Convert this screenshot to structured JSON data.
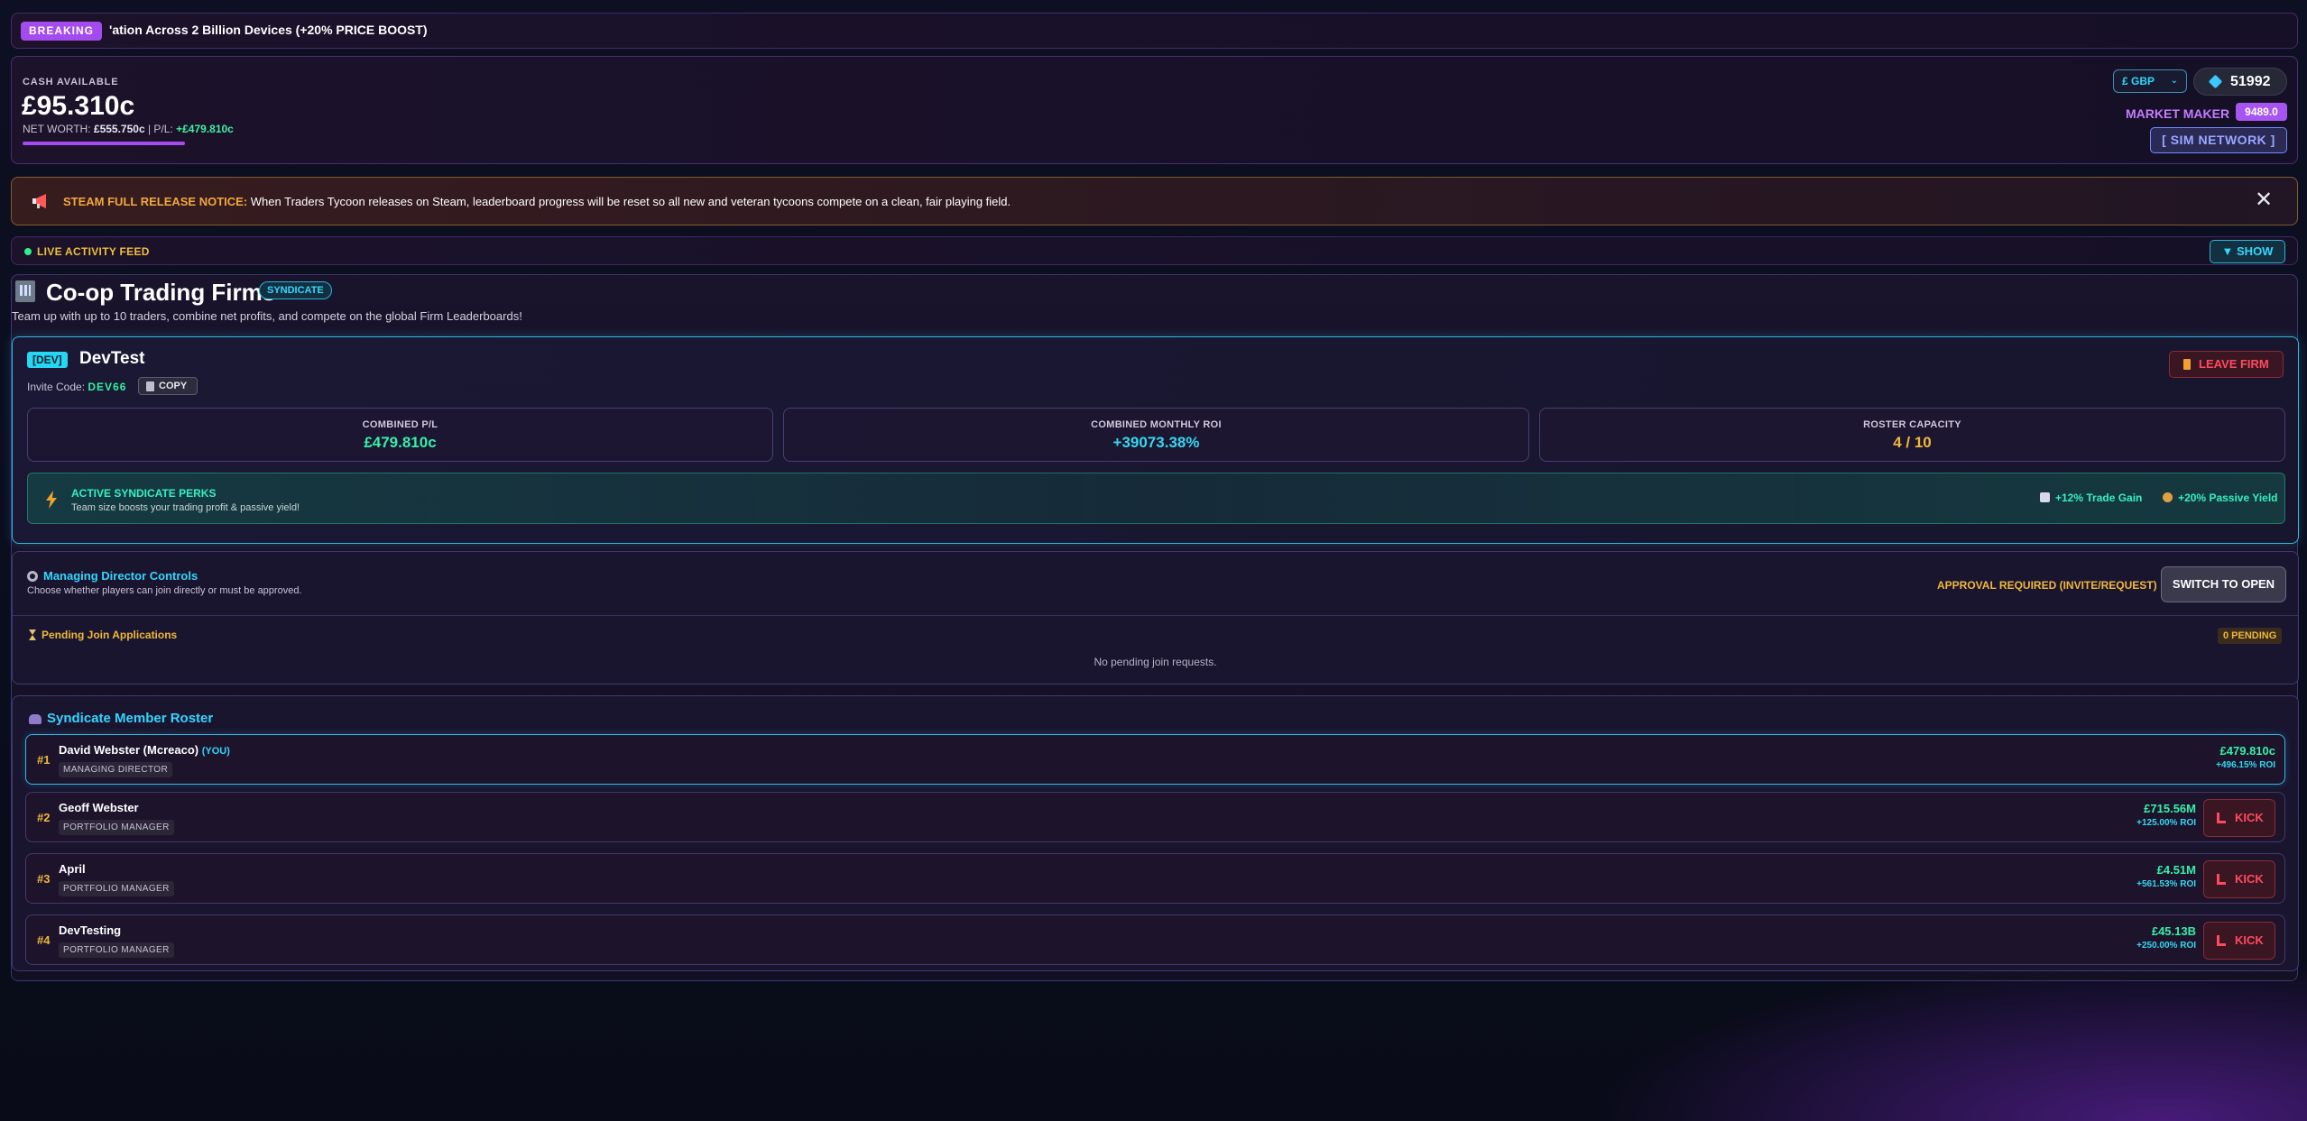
{
  "ticker": {
    "badge": "BREAKING",
    "text": "'ation Across 2 Billion Devices (+20% PRICE BOOST)"
  },
  "header": {
    "cash_label": "CASH AVAILABLE",
    "cash": "£95.310c",
    "networth_label": "NET WORTH:",
    "networth_value": "£555.750c",
    "pl_label": "| P/L:",
    "pl_value": "+£479.810c",
    "currency": "£ GBP",
    "gems": "51992",
    "rank_label": "MARKET MAKER",
    "rank_value": "9489.0",
    "sim_button": "[ SIM NETWORK ]"
  },
  "notice": {
    "title": "STEAM FULL RELEASE NOTICE:",
    "text": "When Traders Tycoon releases on Steam, leaderboard progress will be reset so all new and veteran tycoons compete on a clean, fair playing field."
  },
  "feed": {
    "label": "LIVE ACTIVITY FEED",
    "toggle": "▼ SHOW"
  },
  "page": {
    "title": "Co-op Trading Firms",
    "badge": "SYNDICATE",
    "subtitle": "Team up with up to 10 traders, combine net profits, and compete on the global Firm Leaderboards!"
  },
  "firm": {
    "tag": "[DEV]",
    "name": "DevTest",
    "invite_label": "Invite Code:",
    "invite_code": "DEV66",
    "copy": "COPY",
    "leave": "LEAVE FIRM",
    "stats": [
      {
        "label": "COMBINED P/L",
        "value": "£479.810c",
        "color": "#35f0a8"
      },
      {
        "label": "COMBINED MONTHLY ROI",
        "value": "+39073.38%",
        "color": "#35d8f0"
      },
      {
        "label": "ROSTER CAPACITY",
        "value": "4 / 10",
        "color": "#f0b83a"
      }
    ],
    "perks_title": "ACTIVE SYNDICATE PERKS",
    "perks_sub": "Team size boosts your trading profit & passive yield!",
    "perk_trade": "+12% Trade Gain",
    "perk_yield": "+20% Passive Yield"
  },
  "controls": {
    "title": "Managing Director Controls",
    "subtitle": "Choose whether players can join directly or must be approved.",
    "approval": "APPROVAL REQUIRED (INVITE/REQUEST)",
    "switch": "SWITCH TO OPEN",
    "pending_title": "Pending Join Applications",
    "pending_count": "0 PENDING",
    "none": "No pending join requests."
  },
  "roster": {
    "title": "Syndicate Member Roster",
    "kick_label": "KICK",
    "you_tag": "(YOU)",
    "members": [
      {
        "rank": "#1",
        "name": "David Webster (Mcreaco)",
        "role": "MANAGING DIRECTOR",
        "value": "£479.810c",
        "roi": "+496.15% ROI"
      },
      {
        "rank": "#2",
        "name": "Geoff Webster",
        "role": "PORTFOLIO MANAGER",
        "value": "£715.56M",
        "roi": "+125.00% ROI"
      },
      {
        "rank": "#3",
        "name": "April",
        "role": "PORTFOLIO MANAGER",
        "value": "£4.51M",
        "roi": "+561.53% ROI"
      },
      {
        "rank": "#4",
        "name": "DevTesting",
        "role": "PORTFOLIO MANAGER",
        "value": "£45.13B",
        "roi": "+250.00% ROI"
      }
    ]
  }
}
